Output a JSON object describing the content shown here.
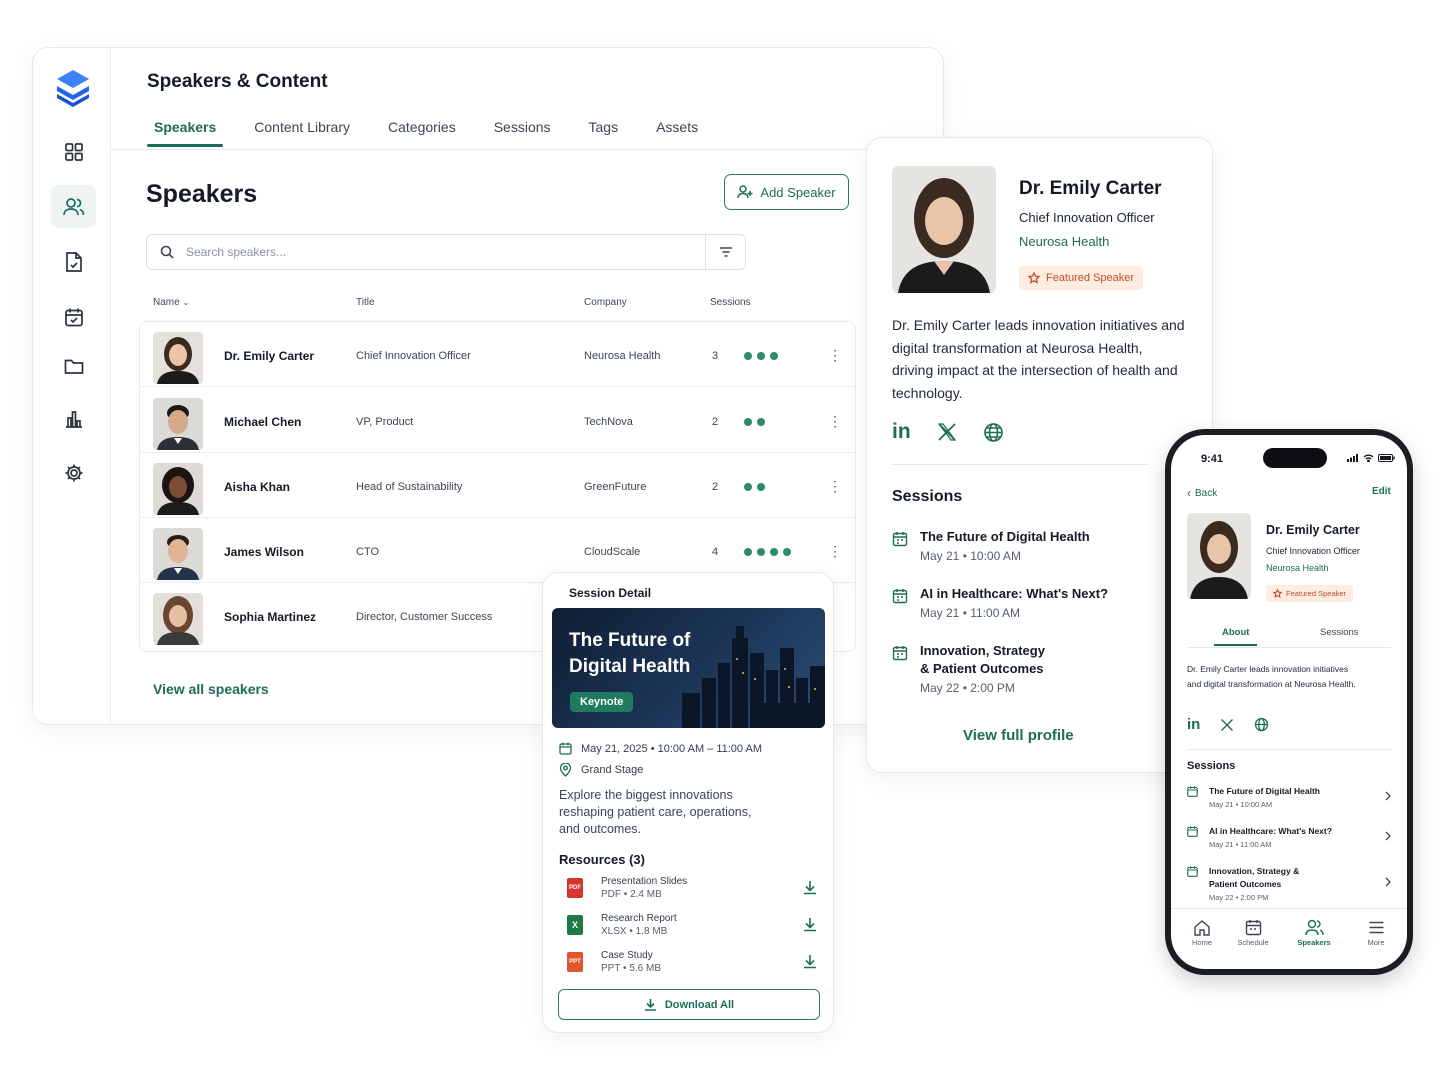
{
  "app": {
    "title": "Speakers & Content",
    "tabs": [
      "Speakers",
      "Content Library",
      "Categories",
      "Sessions",
      "Tags",
      "Assets"
    ],
    "active_tab": "Speakers"
  },
  "speakers_page": {
    "title": "Speakers",
    "add_button": "Add Speaker",
    "search_placeholder": "Search speakers...",
    "columns": [
      "Name",
      "Title",
      "Company",
      "Sessions"
    ],
    "rows": [
      {
        "name": "Dr. Emily Carter",
        "title": "Chief Innovation Officer",
        "company": "Neurosa Health",
        "sessions": "3",
        "dots": 3
      },
      {
        "name": "Michael Chen",
        "title": "VP, Product",
        "company": "TechNova",
        "sessions": "2",
        "dots": 2
      },
      {
        "name": "Aisha Khan",
        "title": "Head of Sustainability",
        "company": "GreenFuture",
        "sessions": "2",
        "dots": 2
      },
      {
        "name": "James Wilson",
        "title": "CTO",
        "company": "CloudScale",
        "sessions": "4",
        "dots": 4
      },
      {
        "name": "Sophia Martinez",
        "title": "Director, Customer Success",
        "company": "",
        "sessions": "",
        "dots": 0
      }
    ],
    "view_all": "View all speakers"
  },
  "profile": {
    "name": "Dr. Emily Carter",
    "role": "Chief Innovation Officer",
    "company": "Neurosa Health",
    "badge": "Featured Speaker",
    "bio": "Dr. Emily Carter leads innovation initiatives and digital transformation at Neurosa Health, driving impact at the intersection of health and technology.",
    "socials": [
      "linkedin-icon",
      "x-icon",
      "globe-icon"
    ],
    "sessions_heading": "Sessions",
    "sessions": [
      {
        "title": "The Future of Digital Health",
        "date": "May 21",
        "time": "10:00 AM"
      },
      {
        "title": "AI in Healthcare: What's Next?",
        "date": "May 21",
        "time": "11:00 AM"
      },
      {
        "title": "Innovation, Strategy & Patient Outcomes",
        "date": "May 22",
        "time": "2:00 PM"
      }
    ],
    "view_full": "View full profile"
  },
  "session_detail": {
    "heading": "Session Detail",
    "hero_title": "The Future of Digital Health",
    "tag": "Keynote",
    "date": "May 21, 2025",
    "time": "10:00 AM – 11:00 AM",
    "location": "Grand Stage",
    "description": "Explore the biggest innovations reshaping patient care, operations, and outcomes.",
    "resources_heading": "Resources (3)",
    "resources": [
      {
        "name": "Presentation Slides",
        "type": "PDF",
        "size": "2.4 MB",
        "color": "#d8342c",
        "icon": "PDF"
      },
      {
        "name": "Research Report",
        "type": "XLSX",
        "size": "1.8 MB",
        "color": "#1f7a45",
        "icon": "X"
      },
      {
        "name": "Case Study",
        "type": "PPT",
        "size": "5.6 MB",
        "color": "#e0562a",
        "icon": "PPT"
      }
    ],
    "download_all": "Download All"
  },
  "mobile": {
    "time": "9:41",
    "back": "Back",
    "edit": "Edit",
    "name": "Dr. Emily Carter",
    "role": "Chief Innovation Officer",
    "company": "Neurosa Health",
    "badge": "Featured Speaker",
    "tabs": [
      "About",
      "Sessions"
    ],
    "bio": "Dr. Emily Carter leads innovation initiatives and digital transformation at Neurosa Health.",
    "sessions_heading": "Sessions",
    "sessions": [
      {
        "title": "The Future of Digital Health",
        "date": "May 21",
        "time": "10:00 AM"
      },
      {
        "title": "AI in Healthcare: What's Next?",
        "date": "May 21",
        "time": "11:00 AM"
      },
      {
        "title": "Innovation, Strategy & Patient Outcomes",
        "date": "May 22",
        "time": "2:00 PM"
      }
    ],
    "nav": [
      "Home",
      "Schedule",
      "Speakers",
      "More"
    ],
    "active_nav": "Speakers"
  },
  "colors": {
    "accent": "#1e6c58",
    "dot": "#2e8a6c",
    "badge_bg": "#fdecdf",
    "badge_text": "#c0512a",
    "logo": "#2b6ee8"
  }
}
